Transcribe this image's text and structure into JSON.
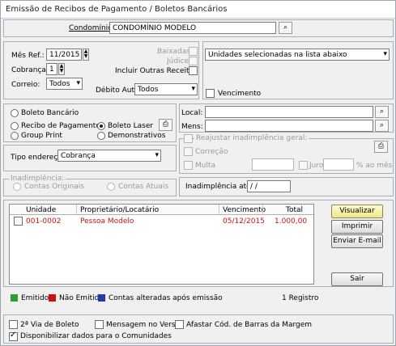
{
  "window": {
    "title": "Emissão de Recibos de Pagamento / Boletos Bancários"
  },
  "condominio": {
    "label": "Condomínio:",
    "value": "CONDOMÍNIO MODELO"
  },
  "form": {
    "mes_ref_label": "Mês Ref.:",
    "mes_ref_value": "11/2015",
    "cobranca_label": "Cobrança:",
    "cobranca_value": "1",
    "correio_label": "Correio:",
    "correio_value": "Todos",
    "baixadas_label": "Baixadas",
    "juizo_label": "Júdice",
    "incluir_label": "Incluir Outras Receitas",
    "debito_label": "Débito Aut.:",
    "debito_value": "Todos",
    "unidades_value": "Unidades selecionadas na lista abaixo",
    "vencimento_label": "Vencimento"
  },
  "tipo_boleto": {
    "boleto_bancario": "Boleto Bancário",
    "recibo_pagamento": "Recibo de Pagamento",
    "boleto_laser": "Boleto Laser",
    "group_print": "Group Print",
    "demonstrativos": "Demonstrativos"
  },
  "local": {
    "local_label": "Local:",
    "mens_label": "Mens:"
  },
  "endereco": {
    "label": "Tipo endereço:",
    "value": "Cobrança"
  },
  "reajustar": {
    "title": "Reajustar inadimplência geral:",
    "correcao": "Correção",
    "multa": "Multa",
    "juros": "Juros",
    "ao_mes": "% ao mês"
  },
  "inadimplencia": {
    "title": "Inadimplência:",
    "contas_originais": "Contas Originais",
    "contas_atuais": "Contas Atuais",
    "ate_label": "Inadimplência até:",
    "ate_value": " / /"
  },
  "table": {
    "headers": [
      "Unidade",
      "Proprietário/Locatário",
      "Vencimento",
      "Total"
    ],
    "rows": [
      {
        "unidade": "001-0002",
        "proprietario": "Pessoa Modelo",
        "vencimento": "05/12/2015",
        "total": "1.000,00"
      }
    ]
  },
  "buttons": {
    "visualizar": "Visualizar",
    "imprimir": "Imprimir",
    "enviar_email": "Enviar E-mail",
    "sair": "Sair"
  },
  "legend": {
    "emitido": "Emitido",
    "nao_emitido": "Não Emitido",
    "contas_alteradas": "Contas alteradas após emissão",
    "count": "1 Registro",
    "colors": {
      "emitido": "#2e9e2e",
      "nao_emitido": "#cc1111",
      "alteradas": "#1f3fa8"
    }
  },
  "options": {
    "segunda_via": "2ª Via de Boleto",
    "mensagem_verso": "Mensagem no Verso",
    "afastar_codigo": "Afastar Cód. de Barras da Margem",
    "disponibilizar": "Disponibilizar dados para o Comunidades"
  },
  "icons": {
    "search": "binoculars-icon",
    "print": "printer-icon"
  }
}
